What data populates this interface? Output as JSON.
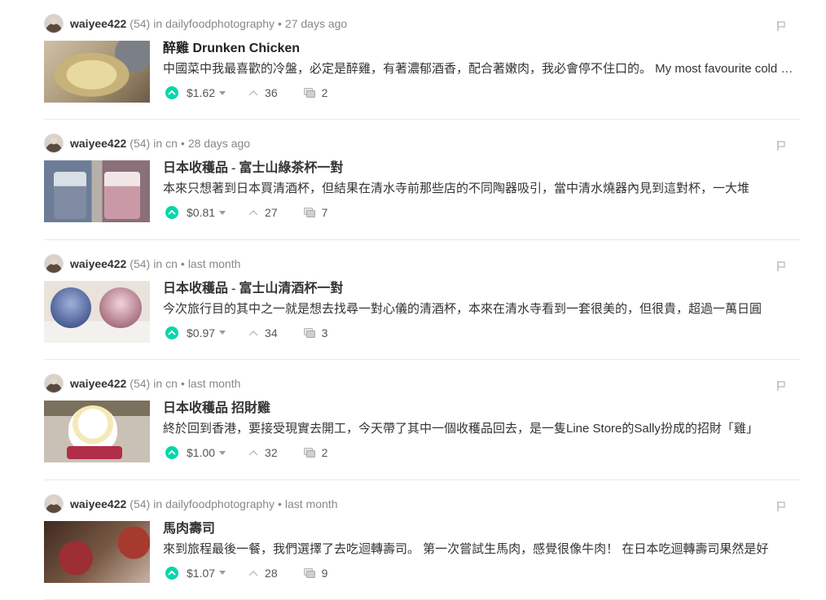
{
  "posts": [
    {
      "author": "waiyee422",
      "reputation": "(54)",
      "in_label": "in",
      "community": "dailyfoodphotography",
      "separator": "•",
      "time": "27 days ago",
      "title": "醉雞 Drunken Chicken",
      "snippet": "中國菜中我最喜歡的冷盤，必定是醉雞，有著濃郁酒香，配合著嫩肉，我必會停不住口的。 My most favourite cold dish in Chinese food",
      "payout": "$1.62",
      "votes": "36",
      "comments": "2"
    },
    {
      "author": "waiyee422",
      "reputation": "(54)",
      "in_label": "in",
      "community": "cn",
      "separator": "•",
      "time": "28 days ago",
      "title": "日本收穫品 - 富士山綠茶杯一對",
      "snippet": "本來只想著到日本買清酒杯，但結果在清水寺前那些店的不同陶器吸引，當中清水燒器內見到這對杯，一大堆",
      "payout": "$0.81",
      "votes": "27",
      "comments": "7"
    },
    {
      "author": "waiyee422",
      "reputation": "(54)",
      "in_label": "in",
      "community": "cn",
      "separator": "•",
      "time": "last month",
      "title": "日本收穫品 - 富士山清酒杯一對",
      "snippet": "今次旅行目的其中之一就是想去找尋一對心儀的清酒杯，本來在清水寺看到一套很美的，但很貴，超過一萬日圓",
      "payout": "$0.97",
      "votes": "34",
      "comments": "3"
    },
    {
      "author": "waiyee422",
      "reputation": "(54)",
      "in_label": "in",
      "community": "cn",
      "separator": "•",
      "time": "last month",
      "title": "日本收穫品 招財雞",
      "snippet": "終於回到香港，要接受現實去開工，今天帶了其中一個收穫品回去，是一隻Line Store的Sally扮成的招財「雞」",
      "payout": "$1.00",
      "votes": "32",
      "comments": "2"
    },
    {
      "author": "waiyee422",
      "reputation": "(54)",
      "in_label": "in",
      "community": "dailyfoodphotography",
      "separator": "•",
      "time": "last month",
      "title": "馬肉壽司",
      "snippet": "來到旅程最後一餐，我們選擇了去吃迴轉壽司。 第一次嘗試生馬肉，感覺很像牛肉！ 在日本吃迴轉壽司果然是好",
      "payout": "$1.07",
      "votes": "28",
      "comments": "9"
    }
  ],
  "icons": {
    "upvote": "upvote-circle-icon",
    "payout_dropdown": "chevron-down-icon",
    "votes": "chevron-up-icon",
    "comments": "comments-icon",
    "flag": "flag-icon"
  },
  "colors": {
    "upvote_accent": "#06d6a9",
    "meta_text": "#888888"
  }
}
